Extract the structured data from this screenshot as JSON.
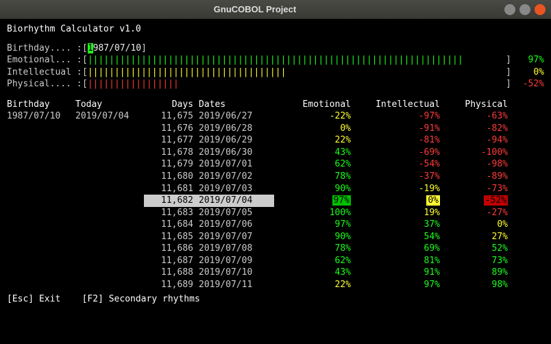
{
  "window": {
    "title": "GnuCOBOL Project"
  },
  "app": {
    "title": "Biorhythm Calculator v1.0"
  },
  "fields": {
    "birthday_label": "Birthday.... :",
    "birthday_cursor": "1",
    "birthday_rest": "987/07/10",
    "emotional_label": "Emotional... :",
    "intellectual_label": "Intellectual :",
    "physical_label": "Physical.... :",
    "emotional_pct": "97%",
    "intellectual_pct": "0%",
    "physical_pct": "-52%",
    "bar_emotional": "||||||||||||||||||||||||||||||||||||||||||||||||||||||||||||||||||||||",
    "bar_intellectual": "|||||||||||||||||||||||||||||||||||||",
    "bar_physical": "|||||||||||||||||"
  },
  "headers": {
    "birthday": "Birthday",
    "today": "Today",
    "days": "Days",
    "dates": "Dates",
    "emotional": "Emotional",
    "intellectual": "Intellectual",
    "physical": "Physical"
  },
  "meta_row": {
    "birthday": "1987/07/10",
    "today": "2019/07/04"
  },
  "rows": [
    {
      "days": "11,675",
      "date": "2019/06/27",
      "e": "-22%",
      "ec": "y",
      "i": "-97%",
      "ic": "r",
      "p": "-63%",
      "pc": "r"
    },
    {
      "days": "11,676",
      "date": "2019/06/28",
      "e": "0%",
      "ec": "y",
      "i": "-91%",
      "ic": "r",
      "p": "-82%",
      "pc": "r"
    },
    {
      "days": "11,677",
      "date": "2019/06/29",
      "e": "22%",
      "ec": "y",
      "i": "-81%",
      "ic": "r",
      "p": "-94%",
      "pc": "r"
    },
    {
      "days": "11,678",
      "date": "2019/06/30",
      "e": "43%",
      "ec": "g",
      "i": "-69%",
      "ic": "r",
      "p": "-100%",
      "pc": "r"
    },
    {
      "days": "11,679",
      "date": "2019/07/01",
      "e": "62%",
      "ec": "g",
      "i": "-54%",
      "ic": "r",
      "p": "-98%",
      "pc": "r"
    },
    {
      "days": "11,680",
      "date": "2019/07/02",
      "e": "78%",
      "ec": "g",
      "i": "-37%",
      "ic": "r",
      "p": "-89%",
      "pc": "r"
    },
    {
      "days": "11,681",
      "date": "2019/07/03",
      "e": "90%",
      "ec": "g",
      "i": "-19%",
      "ic": "y",
      "p": "-73%",
      "pc": "r"
    },
    {
      "days": "11,682",
      "date": "2019/07/04",
      "e": "97%",
      "ec": "g",
      "i": "0%",
      "ic": "y",
      "p": "-52%",
      "pc": "r",
      "hl": true
    },
    {
      "days": "11,683",
      "date": "2019/07/05",
      "e": "100%",
      "ec": "g",
      "i": "19%",
      "ic": "y",
      "p": "-27%",
      "pc": "r"
    },
    {
      "days": "11,684",
      "date": "2019/07/06",
      "e": "97%",
      "ec": "g",
      "i": "37%",
      "ic": "g",
      "p": "0%",
      "pc": "y"
    },
    {
      "days": "11,685",
      "date": "2019/07/07",
      "e": "90%",
      "ec": "g",
      "i": "54%",
      "ic": "g",
      "p": "27%",
      "pc": "y"
    },
    {
      "days": "11,686",
      "date": "2019/07/08",
      "e": "78%",
      "ec": "g",
      "i": "69%",
      "ic": "g",
      "p": "52%",
      "pc": "g"
    },
    {
      "days": "11,687",
      "date": "2019/07/09",
      "e": "62%",
      "ec": "g",
      "i": "81%",
      "ic": "g",
      "p": "73%",
      "pc": "g"
    },
    {
      "days": "11,688",
      "date": "2019/07/10",
      "e": "43%",
      "ec": "g",
      "i": "91%",
      "ic": "g",
      "p": "89%",
      "pc": "g"
    },
    {
      "days": "11,689",
      "date": "2019/07/11",
      "e": "22%",
      "ec": "y",
      "i": "97%",
      "ic": "g",
      "p": "98%",
      "pc": "g"
    }
  ],
  "footer": {
    "esc": "[Esc] Exit",
    "f2": "[F2] Secondary rhythms"
  }
}
